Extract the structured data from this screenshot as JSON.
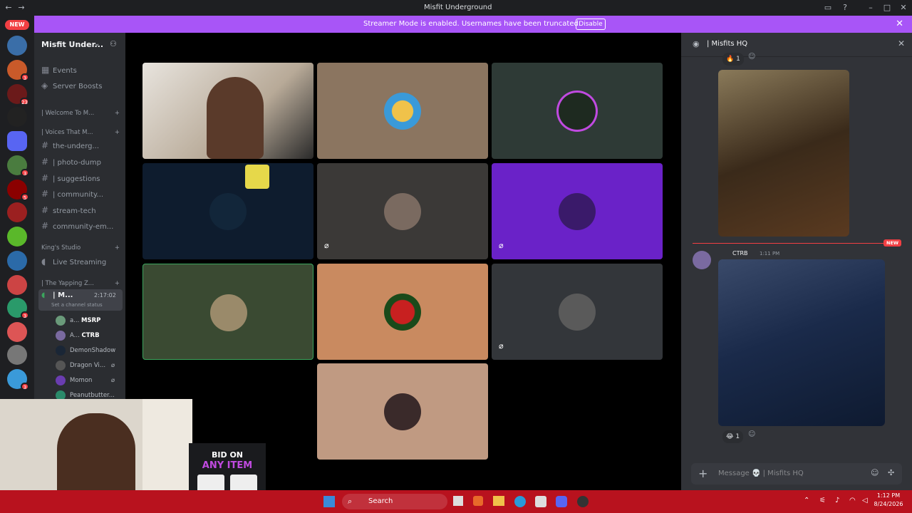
{
  "window": {
    "title": "Misfit Underground"
  },
  "banner": {
    "text": "Streamer Mode is enabled. Usernames have been truncated.",
    "button": "Disable"
  },
  "rail": {
    "new_label": "NEW",
    "badges": [
      "3",
      "23",
      "3",
      "5",
      "3",
      "3"
    ]
  },
  "sidebar": {
    "server_name": "Misfit Under...",
    "events": "Events",
    "boosts": "Server Boosts",
    "cat_welcome": "| Welcome To M...",
    "cat_voices": "| Voices That M...",
    "channels": [
      {
        "label": "the-underg..."
      },
      {
        "label": "| photo-dump"
      },
      {
        "label": "| suggestions"
      },
      {
        "label": "| community..."
      },
      {
        "label": "stream-tech"
      },
      {
        "label": "community-em..."
      }
    ],
    "cat_kings": "King's Studio",
    "live_streaming": "Live Streaming",
    "cat_yapping": "| The Yapping Z...",
    "voice_channel": "| M...",
    "voice_timer": "2:17:02",
    "channel_status": "Set a channel status",
    "voice_users": [
      {
        "name": "a...",
        "tag": "MSRP"
      },
      {
        "name": "A...",
        "tag": "CTRB"
      },
      {
        "name": "DemonShadow"
      },
      {
        "name": "Dragon Vi..."
      },
      {
        "name": "Momon"
      },
      {
        "name": "Peanutbutter..."
      }
    ]
  },
  "chat": {
    "channel": "| Misfits HQ",
    "reaction_top": "1",
    "author_tag": "CTRB",
    "time": "1:11 PM",
    "new_marker": "NEW",
    "reaction_bottom": "1",
    "composer_placeholder": "Message 💀 | Misfits HQ"
  },
  "ad": {
    "line1": "BID ON",
    "line2": "ANY ITEM"
  },
  "taskbar": {
    "search": "Search",
    "time": "1:12 PM",
    "date": "8/24/2026"
  },
  "colors": {
    "accent": "#a855f7",
    "taskbar": "#b8121e",
    "speaking": "#3ba55d"
  }
}
